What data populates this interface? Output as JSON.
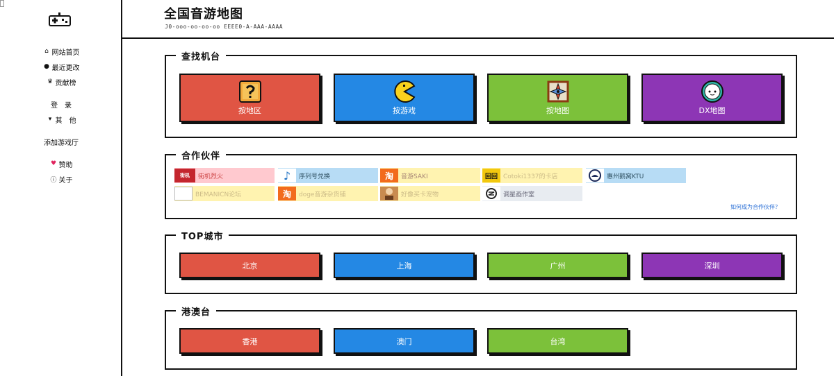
{
  "header": {
    "title": "全国音游地图",
    "subtitle": "J0-ooo-oo-oo-oo EEEE0-A-AAA-AAAA"
  },
  "sidebar": {
    "logo_icon": "gamepad-icon",
    "items": [
      {
        "icon": "home-icon",
        "label": "网站首页"
      },
      {
        "icon": "clock-icon",
        "label": "最近更改"
      },
      {
        "icon": "trophy-icon",
        "label": "贡献榜"
      },
      {
        "icon": "",
        "label": "登　录"
      },
      {
        "icon": "caret-down-icon",
        "label": "其　他"
      },
      {
        "icon": "",
        "label": "添加游戏厅"
      },
      {
        "icon": "heart-icon",
        "label": "赞助"
      },
      {
        "icon": "info-icon",
        "label": "关于"
      }
    ]
  },
  "find": {
    "title": "查找机台",
    "buttons": [
      {
        "label": "按地区",
        "icon": "question-block-icon",
        "color": "#e05544"
      },
      {
        "label": "按游戏",
        "icon": "pacman-icon",
        "color": "#2488e4"
      },
      {
        "label": "按地图",
        "icon": "compass-icon",
        "color": "#7cc13a"
      },
      {
        "label": "DX地图",
        "icon": "maimai-icon",
        "color": "#8d36b5"
      }
    ]
  },
  "partners": {
    "title": "合作伙伴",
    "items": [
      {
        "label": "街机烈火",
        "icon": "jijilieHuo-logo-icon",
        "bg": "#ffc9cf",
        "color": "#c44"
      },
      {
        "label": "序列号兑换",
        "icon": "music-note-icon",
        "bg": "#b7dcf5",
        "color": "#356"
      },
      {
        "label": "音游SAKI",
        "icon": "taobao-icon",
        "bg": "#fff3b0",
        "color": "#a87"
      },
      {
        "label": "Cotoki1337的卡店",
        "icon": "shop-logo-icon",
        "bg": "#fff3b0",
        "color": "#cb8"
      },
      {
        "label": "惠州鹅窝KTU",
        "icon": "ktu-logo-icon",
        "bg": "#b7dcf5",
        "color": "#356"
      },
      {
        "label": "BEMANICN论坛",
        "icon": "broken-image-icon",
        "bg": "#fff3b0",
        "color": "#cb8"
      },
      {
        "label": "doge音游杂货铺",
        "icon": "taobao-icon",
        "bg": "#fff3b0",
        "color": "#cb8"
      },
      {
        "label": "好像买卡宠物",
        "icon": "avatar-icon",
        "bg": "#fff3b0",
        "color": "#cb8"
      },
      {
        "label": "调星画作室",
        "icon": "studio-logo-icon",
        "bg": "#e8ecf1",
        "color": "#667"
      }
    ],
    "join_link": "如何成为合作伙伴？"
  },
  "top_cities": {
    "title": "TOP城市",
    "items": [
      "北京",
      "上海",
      "广州",
      "深圳"
    ]
  },
  "hmt": {
    "title": "港澳台",
    "items": [
      "香港",
      "澳门",
      "台湾"
    ]
  }
}
